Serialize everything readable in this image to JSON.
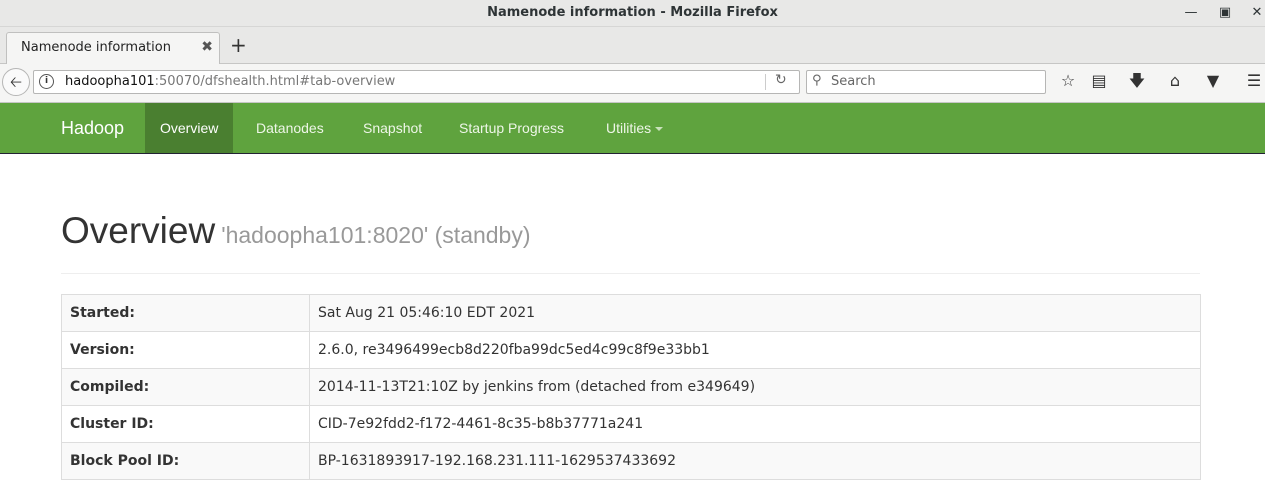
{
  "window": {
    "title": "Namenode information - Mozilla Firefox"
  },
  "tab": {
    "title": "Namenode information"
  },
  "urlbar": {
    "host": "hadoopha101",
    "rest": ":50070/dfshealth.html#tab-overview"
  },
  "search": {
    "placeholder": "Search"
  },
  "hadoop_nav": {
    "brand": "Hadoop",
    "items": [
      "Overview",
      "Datanodes",
      "Snapshot",
      "Startup Progress",
      "Utilities"
    ]
  },
  "overview": {
    "title": "Overview",
    "subtitle": "'hadoopha101:8020' (standby)",
    "rows": [
      {
        "key": "Started:",
        "value": "Sat Aug 21 05:46:10 EDT 2021"
      },
      {
        "key": "Version:",
        "value": "2.6.0, re3496499ecb8d220fba99dc5ed4c99c8f9e33bb1"
      },
      {
        "key": "Compiled:",
        "value": "2014-11-13T21:10Z by jenkins from (detached from e349649)"
      },
      {
        "key": "Cluster ID:",
        "value": "CID-7e92fdd2-f172-4461-8c35-b8b37771a241"
      },
      {
        "key": "Block Pool ID:",
        "value": "BP-1631893917-192.168.231.111-1629537433692"
      }
    ]
  },
  "icons": {
    "minimize": "minimize-icon",
    "maximize": "maximize-icon",
    "close": "close-icon",
    "back": "back-arrow-icon",
    "info": "info-icon",
    "reload": "reload-icon",
    "search": "search-icon",
    "bookmark": "star-icon",
    "reader": "reading-list-icon",
    "download": "download-icon",
    "home": "home-icon",
    "pocket": "pocket-icon",
    "menu": "hamburger-menu-icon"
  },
  "colors": {
    "hadoop_green": "#5fa33e",
    "active_tab": "#4a7f30"
  }
}
